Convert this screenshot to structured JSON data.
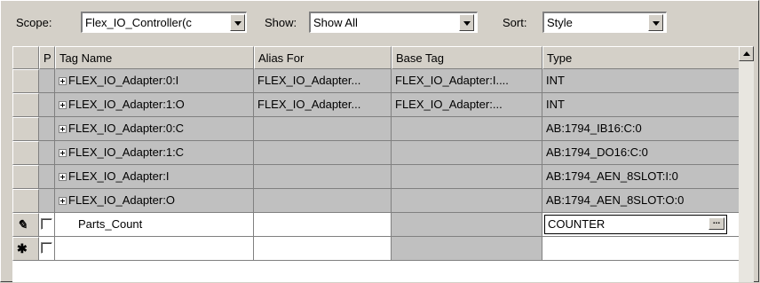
{
  "toolbar": {
    "scope_label": "Scope:",
    "scope_value": "Flex_IO_Controller(c",
    "show_label": "Show:",
    "show_value": "Show All",
    "sort_label": "Sort:",
    "sort_value": "Style"
  },
  "columns": {
    "p": "P",
    "tag_name": "Tag Name",
    "alias_for": "Alias For",
    "base_tag": "Base Tag",
    "type": "Type"
  },
  "rows": [
    {
      "tag": "FLEX_IO_Adapter:0:I",
      "alias": "FLEX_IO_Adapter...",
      "base": "FLEX_IO_Adapter:I....",
      "type": "INT"
    },
    {
      "tag": "FLEX_IO_Adapter:1:O",
      "alias": "FLEX_IO_Adapter...",
      "base": "FLEX_IO_Adapter:...",
      "type": "INT"
    },
    {
      "tag": "FLEX_IO_Adapter:0:C",
      "alias": "",
      "base": "",
      "type": "AB:1794_IB16:C:0"
    },
    {
      "tag": "FLEX_IO_Adapter:1:C",
      "alias": "",
      "base": "",
      "type": "AB:1794_DO16:C:0"
    },
    {
      "tag": "FLEX_IO_Adapter:I",
      "alias": "",
      "base": "",
      "type": "AB:1794_AEN_8SLOT:I:0"
    },
    {
      "tag": "FLEX_IO_Adapter:O",
      "alias": "",
      "base": "",
      "type": "AB:1794_AEN_8SLOT:O:0"
    }
  ],
  "edit_row": {
    "row_icon": "✎",
    "tag": "Parts_Count",
    "type": "COUNTER",
    "browse": "..."
  },
  "new_row": {
    "row_icon": "✱"
  },
  "colors": {
    "window_bg": "#d4d0c8",
    "cell_gray": "#c0c0c0",
    "cell_white": "#ffffff"
  }
}
